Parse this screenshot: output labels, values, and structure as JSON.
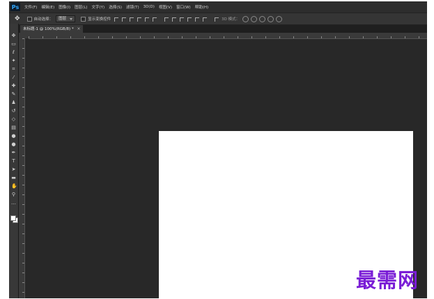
{
  "app": {
    "logo": "Ps",
    "menu": [
      "文件(F)",
      "编辑(E)",
      "图像(I)",
      "图层(L)",
      "文字(Y)",
      "选择(S)",
      "滤镜(T)",
      "3D(D)",
      "视图(V)",
      "窗口(W)",
      "帮助(H)"
    ]
  },
  "options_bar": {
    "auto_select_label": "自动选择：",
    "auto_select_value": "图层",
    "transform_label": "显示变换控件",
    "mode_3d_label": "3D 模式："
  },
  "document": {
    "tab_title": "未标题-1 @ 100%(RGB/8) *",
    "close_glyph": "×"
  },
  "toolbox": {
    "tools": [
      {
        "name": "move-tool-icon",
        "glyph": "✥"
      },
      {
        "name": "marquee-tool-icon",
        "glyph": "▭"
      },
      {
        "name": "lasso-tool-icon",
        "glyph": "ℓ"
      },
      {
        "name": "magic-wand-tool-icon",
        "glyph": "✦"
      },
      {
        "name": "crop-tool-icon",
        "glyph": "⌗"
      },
      {
        "name": "eyedropper-tool-icon",
        "glyph": "⁄"
      },
      {
        "name": "healing-brush-tool-icon",
        "glyph": "✚"
      },
      {
        "name": "brush-tool-icon",
        "glyph": "✎"
      },
      {
        "name": "clone-stamp-tool-icon",
        "glyph": "♟"
      },
      {
        "name": "history-brush-tool-icon",
        "glyph": "↺"
      },
      {
        "name": "eraser-tool-icon",
        "glyph": "◇"
      },
      {
        "name": "gradient-tool-icon",
        "glyph": "▤"
      },
      {
        "name": "blur-tool-icon",
        "glyph": "●"
      },
      {
        "name": "dodge-tool-icon",
        "glyph": "●"
      },
      {
        "name": "pen-tool-icon",
        "glyph": "✒"
      },
      {
        "name": "type-tool-icon",
        "glyph": "T"
      },
      {
        "name": "path-selection-tool-icon",
        "glyph": "➤"
      },
      {
        "name": "rectangle-tool-icon",
        "glyph": "▬"
      },
      {
        "name": "hand-tool-icon",
        "glyph": "✋"
      },
      {
        "name": "zoom-tool-icon",
        "glyph": "⚲"
      },
      {
        "name": "more-tools-icon",
        "glyph": "…"
      }
    ]
  },
  "watermark": {
    "text": "最需网",
    "color": "#7a1dd6"
  }
}
